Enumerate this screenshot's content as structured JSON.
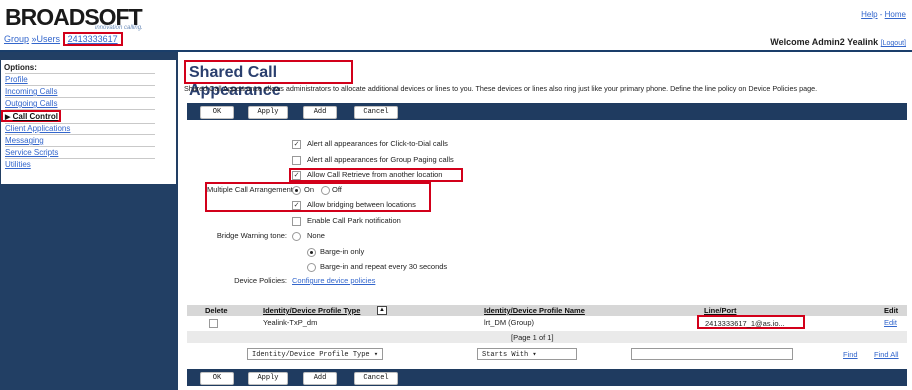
{
  "brand": {
    "logo": "BROADSOFT",
    "tagline": "innovation calling."
  },
  "header": {
    "help": "Help",
    "sep": " - ",
    "home": "Home",
    "welcome": "Welcome Admin2 Yealink",
    "logout": "[Logout]"
  },
  "breadcrumb": {
    "group": "Group",
    "users": "»Users",
    "user_id": "2413333617"
  },
  "sidebar": {
    "title": "Options:",
    "items": [
      {
        "label": "Profile"
      },
      {
        "label": "Incoming Calls"
      },
      {
        "label": "Outgoing Calls"
      },
      {
        "label": "Call Control",
        "active": true
      },
      {
        "label": "Client Applications"
      },
      {
        "label": "Messaging"
      },
      {
        "label": "Service Scripts"
      },
      {
        "label": "Utilities"
      }
    ]
  },
  "page": {
    "title": "Shared Call Appearance",
    "description": "Shared Call Appearance allows administrators to allocate additional devices or lines to you. These devices or lines also ring just like your primary phone. Define the line policy on Device Policies page."
  },
  "buttons": {
    "ok": "OK",
    "apply": "Apply",
    "add": "Add",
    "cancel": "Cancel"
  },
  "settings": {
    "alert_click_to_dial": {
      "label": "Alert all appearances for Click-to-Dial calls",
      "checked": true
    },
    "alert_group_paging": {
      "label": "Alert all appearances for Group Paging calls",
      "checked": false
    },
    "allow_call_retrieve": {
      "label": "Allow Call Retrieve from another location",
      "checked": true
    },
    "multiple_call_arrangement": {
      "label": "Multiple Call Arrangement:",
      "on": "On",
      "off": "Off",
      "value": "On"
    },
    "allow_bridging": {
      "label": "Allow bridging between locations",
      "checked": true
    },
    "enable_call_park": {
      "label": "Enable Call Park notification",
      "checked": false
    },
    "bridge_warning_tone": {
      "label": "Bridge Warning tone:",
      "options": [
        "None",
        "Barge-in only",
        "Barge-in and repeat every 30 seconds"
      ],
      "value": "Barge-in only"
    },
    "device_policies": {
      "label": "Device Policies:",
      "link": "Configure device policies"
    }
  },
  "table": {
    "headers": {
      "delete": "Delete",
      "type": "Identity/Device Profile Type",
      "sort": "▲",
      "name": "Identity/Device Profile Name",
      "line": "Line/Port",
      "edit": "Edit"
    },
    "rows": [
      {
        "type": "Yealink-TxP_dm",
        "name": "lrt_DM (Group)",
        "line": "2413333617_1@as.io...",
        "edit": "Edit"
      }
    ],
    "pagination": "[Page 1 of 1]"
  },
  "search": {
    "field": "Identity/Device Profile Type",
    "mode": "Starts With",
    "value": "",
    "find": "Find",
    "find_all": "Find All"
  }
}
